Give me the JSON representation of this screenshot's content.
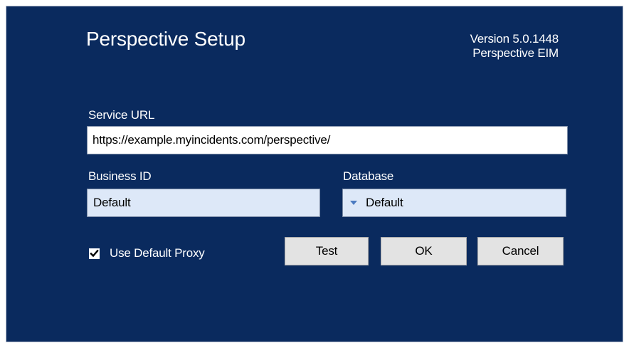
{
  "window": {
    "title": "Perspective Setup",
    "version_line": "Version  5.0.1448",
    "product_line": "Perspective  EIM"
  },
  "form": {
    "service_url_label": "Service URL",
    "service_url_value": "https://example.myincidents.com/perspective/",
    "business_id_label": "Business ID",
    "business_id_value": "Default",
    "database_label": "Database",
    "database_value": "Default",
    "use_default_proxy_label": "Use Default Proxy",
    "use_default_proxy_checked": true
  },
  "buttons": {
    "test": "Test",
    "ok": "OK",
    "cancel": "Cancel"
  },
  "colors": {
    "background": "#0a2a5e",
    "field_readonly": "#dde8f8",
    "dropdown_arrow": "#4c7bc1",
    "button_face": "#e3e3e3"
  },
  "icons": {
    "checkbox": "checkmark-icon",
    "dropdown": "dropdown-arrow-icon"
  }
}
